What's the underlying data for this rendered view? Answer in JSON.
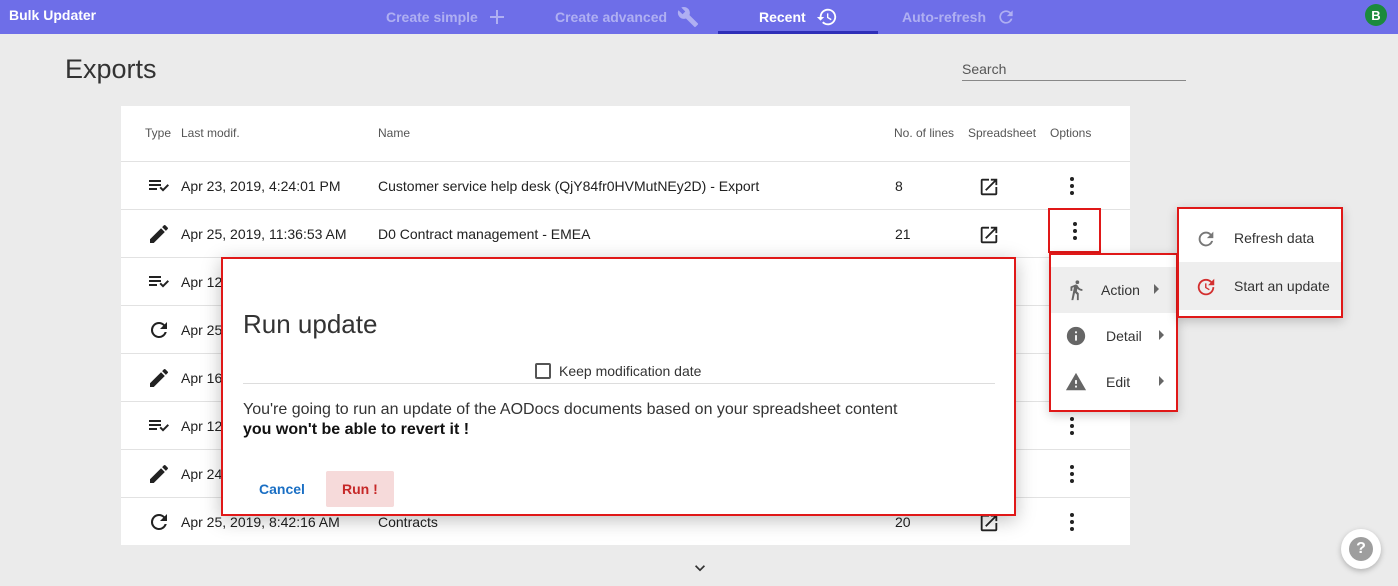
{
  "app": {
    "title": "Bulk Updater",
    "user_initial": "B"
  },
  "nav": {
    "tabs": [
      {
        "label": "Create simple",
        "icon": "plus-icon"
      },
      {
        "label": "Create advanced",
        "icon": "wrench-icon"
      },
      {
        "label": "Recent",
        "icon": "history-icon"
      },
      {
        "label": "Auto-refresh",
        "icon": "refresh-icon"
      }
    ],
    "active_tab": "Recent"
  },
  "page": {
    "title": "Exports",
    "search_placeholder": "Search"
  },
  "table": {
    "headers": {
      "type": "Type",
      "last_modif": "Last modif.",
      "name": "Name",
      "lines": "No. of lines",
      "spreadsheet": "Spreadsheet",
      "options": "Options"
    },
    "rows": [
      {
        "type_icon": "list-check-icon",
        "last_modif": "Apr 23, 2019, 4:24:01 PM",
        "name": "Customer service help desk (QjY84fr0HVMutNEy2D) - Export",
        "lines": "8"
      },
      {
        "type_icon": "pencil-icon",
        "last_modif": "Apr 25, 2019, 11:36:53 AM",
        "name": "D0 Contract management - EMEA",
        "lines": "21"
      },
      {
        "type_icon": "list-check-icon",
        "last_modif": "Apr 12",
        "name": "",
        "lines": ""
      },
      {
        "type_icon": "refresh-icon",
        "last_modif": "Apr 25",
        "name": "",
        "lines": ""
      },
      {
        "type_icon": "pencil-icon",
        "last_modif": "Apr 16",
        "name": "",
        "lines": ""
      },
      {
        "type_icon": "list-check-icon",
        "last_modif": "Apr 12",
        "name": "",
        "lines": ""
      },
      {
        "type_icon": "pencil-icon",
        "last_modif": "Apr 24",
        "name": "",
        "lines": ""
      },
      {
        "type_icon": "refresh-icon",
        "last_modif": "Apr 25, 2019, 8:42:16 AM",
        "name": "Contracts",
        "lines": "20"
      }
    ]
  },
  "dialog": {
    "title": "Run update",
    "checkbox_label": "Keep modification date",
    "message": "You're going to run an update of the AODocs documents based on your spreadsheet content",
    "warning": "you won't be able to revert it !",
    "cancel_label": "Cancel",
    "run_label": "Run !"
  },
  "menu": {
    "items": [
      {
        "label": "Action",
        "icon": "running-person-icon"
      },
      {
        "label": "Detail",
        "icon": "info-icon"
      },
      {
        "label": "Edit",
        "icon": "warning-icon"
      }
    ]
  },
  "submenu": {
    "items": [
      {
        "label": "Refresh data",
        "icon": "refresh-icon"
      },
      {
        "label": "Start an update",
        "icon": "update-icon"
      }
    ]
  },
  "colors": {
    "topbar": "#6e6ee8",
    "accent_red": "#e01818",
    "link_blue": "#1a6fc4"
  }
}
